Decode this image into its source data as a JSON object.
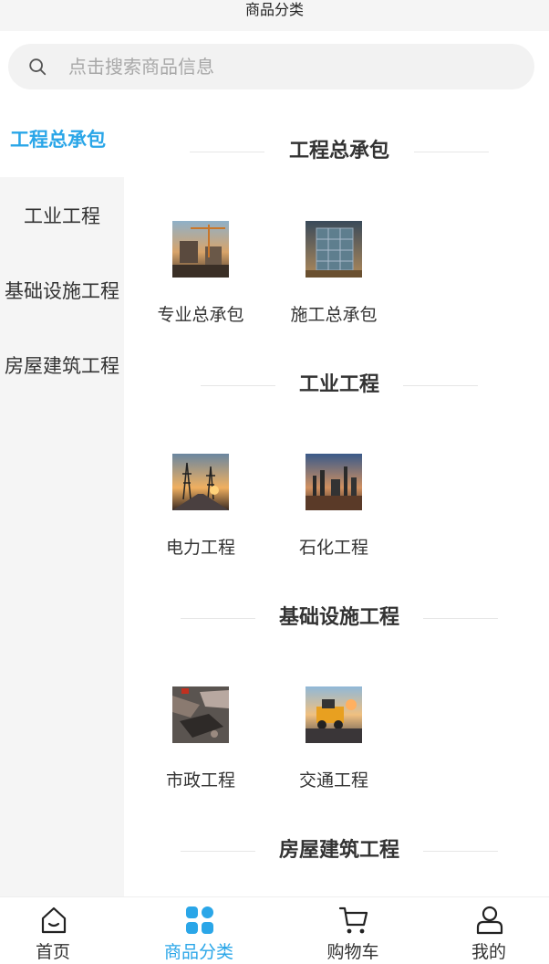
{
  "header": {
    "title": "商品分类"
  },
  "search": {
    "placeholder": "点击搜索商品信息"
  },
  "sidebar": {
    "items": [
      {
        "label": "工程总承包",
        "active": true
      },
      {
        "label": "工业工程",
        "active": false
      },
      {
        "label": "基础设施工程",
        "active": false
      },
      {
        "label": "房屋建筑工程",
        "active": false
      }
    ]
  },
  "sections": [
    {
      "title": "工程总承包",
      "products": [
        {
          "label": "专业总承包",
          "image": "construction-site-cranes"
        },
        {
          "label": "施工总承包",
          "image": "glass-building-scaffold"
        }
      ]
    },
    {
      "title": "工业工程",
      "products": [
        {
          "label": "电力工程",
          "image": "power-transmission-towers"
        },
        {
          "label": "石化工程",
          "image": "petrochemical-plant"
        }
      ]
    },
    {
      "title": "基础设施工程",
      "products": [
        {
          "label": "市政工程",
          "image": "municipal-pipes"
        },
        {
          "label": "交通工程",
          "image": "road-paving-machine"
        }
      ]
    },
    {
      "title": "房屋建筑工程",
      "products": []
    }
  ],
  "tabbar": {
    "items": [
      {
        "label": "首页",
        "icon": "home-icon",
        "active": false
      },
      {
        "label": "商品分类",
        "icon": "category-grid-icon",
        "active": true
      },
      {
        "label": "购物车",
        "icon": "cart-icon",
        "active": false
      },
      {
        "label": "我的",
        "icon": "user-icon",
        "active": false
      }
    ]
  },
  "colors": {
    "accent": "#2aa6e8",
    "sidebar_bg": "#f5f5f5",
    "search_bg": "#f2f2f2"
  }
}
